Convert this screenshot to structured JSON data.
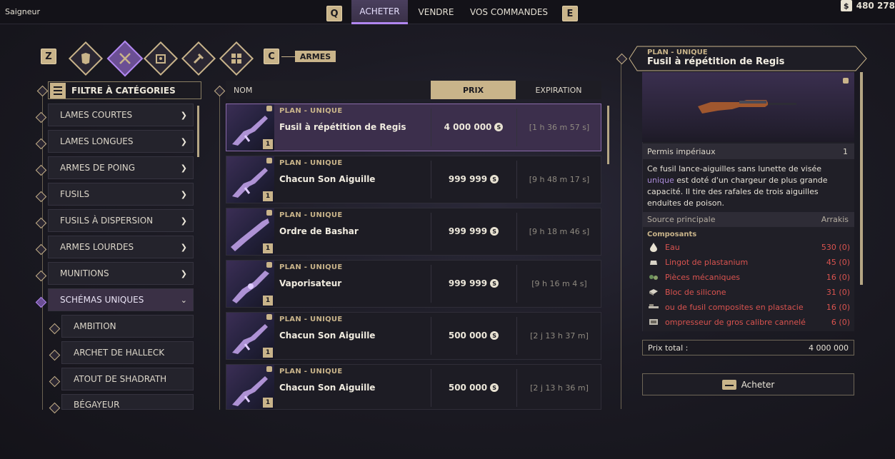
{
  "topbar": {
    "player_name": "Saigneur",
    "left_key": "Q",
    "right_key": "E",
    "tabs": [
      "ACHETER",
      "VENDRE",
      "VOS COMMANDES"
    ],
    "currency_amount": "480 278"
  },
  "category_bar": {
    "left_key": "Z",
    "right_key": "C",
    "selected_label": "ARMES",
    "icons": [
      "armor-icon",
      "weapons-icon",
      "utility-icon",
      "tools-icon",
      "components-icon"
    ]
  },
  "filter": {
    "title": "FILTRE À CATÉGORIES",
    "categories": [
      {
        "label": "LAMES COURTES"
      },
      {
        "label": "LAMES LONGUES"
      },
      {
        "label": "ARMES DE POING"
      },
      {
        "label": "FUSILS"
      },
      {
        "label": "FUSILS À DISPERSION"
      },
      {
        "label": "ARMES LOURDES"
      },
      {
        "label": "MUNITIONS"
      },
      {
        "label": "SCHÉMAS UNIQUES"
      }
    ],
    "subcategories": [
      {
        "label": "AMBITION"
      },
      {
        "label": "ARCHET DE HALLECK"
      },
      {
        "label": "ATOUT DE SHADRATH"
      },
      {
        "label": "BÉGAYEUR"
      }
    ]
  },
  "listing": {
    "columns": {
      "name": "NOM",
      "price": "PRIX",
      "expiration": "EXPIRATION"
    },
    "rows": [
      {
        "kind": "PLAN - UNIQUE",
        "name": "Fusil à répétition de Regis",
        "price": "4 000 000",
        "expiration": "[1 h 36 m 57 s]",
        "tier": "1"
      },
      {
        "kind": "PLAN - UNIQUE",
        "name": "Chacun Son Aiguille",
        "price": "999 999",
        "expiration": "[9 h 48 m 17 s]",
        "tier": "1"
      },
      {
        "kind": "PLAN - UNIQUE",
        "name": "Ordre de Bashar",
        "price": "999 999",
        "expiration": "[9 h 18 m 46 s]",
        "tier": "1"
      },
      {
        "kind": "PLAN - UNIQUE",
        "name": "Vaporisateur",
        "price": "999 999",
        "expiration": "[9 h 16 m 4 s]",
        "tier": "1"
      },
      {
        "kind": "PLAN - UNIQUE",
        "name": "Chacun Son Aiguille",
        "price": "500 000",
        "expiration": "[2 j 13 h 37 m]",
        "tier": "1"
      },
      {
        "kind": "PLAN - UNIQUE",
        "name": "Chacun Son Aiguille",
        "price": "500 000",
        "expiration": "[2 j 13 h 36 m]",
        "tier": "1"
      }
    ]
  },
  "detail": {
    "kind": "PLAN - UNIQUE",
    "title": "Fusil à répétition de Regis",
    "permit_label": "Permis impériaux",
    "permit_value": "1",
    "desc_before": "Ce fusil lance-aiguilles sans lunette de visée ",
    "desc_highlight": "unique",
    "desc_after": " est doté d'un chargeur de plus grande capacité. Il tire des rafales de trois aiguilles enduites de poison.",
    "source_label": "Source principale",
    "source_value": "Arrakis",
    "components_title": "Composants",
    "components": [
      {
        "name": "Eau",
        "qty": "530 (0)",
        "icon": "water-drop-icon"
      },
      {
        "name": "Lingot de plastanium",
        "qty": "45 (0)",
        "icon": "ingot-icon"
      },
      {
        "name": "Pièces mécaniques",
        "qty": "16 (0)",
        "icon": "gear-parts-icon"
      },
      {
        "name": "Bloc de silicone",
        "qty": "31 (0)",
        "icon": "block-icon"
      },
      {
        "name": "ou de fusil composites en plastacie",
        "qty": "16 (0)",
        "icon": "rifle-part-icon"
      },
      {
        "name": "ompresseur de gros calibre cannelé",
        "qty": "6 (0)",
        "icon": "compressor-icon"
      }
    ],
    "total_label": "Prix total :",
    "total_value": "4 000 000",
    "buy_label": "Acheter"
  },
  "colors": {
    "accent_gold": "#c9b48a",
    "accent_purple": "#b187f0",
    "missing_red": "#d9534f"
  }
}
